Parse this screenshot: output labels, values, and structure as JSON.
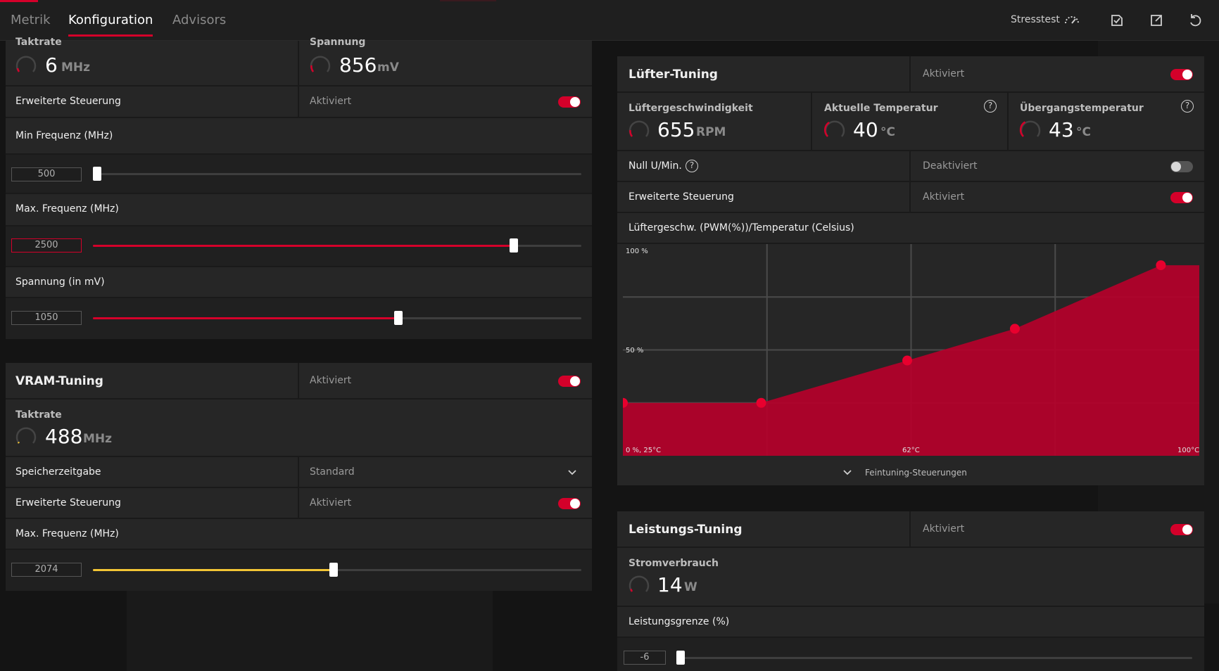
{
  "tabs": [
    {
      "label": "Metrik",
      "active": false
    },
    {
      "label": "Konfiguration",
      "active": true
    },
    {
      "label": "Advisors",
      "active": false
    }
  ],
  "toolbar": {
    "stress_label": "Stresstest"
  },
  "gpu_tuning": {
    "clock_label": "Taktrate",
    "clock_value": "6",
    "clock_unit": "MHz",
    "voltage_label": "Spannung",
    "voltage_value": "856",
    "voltage_unit": "mV",
    "advanced_label": "Erweiterte Steuerung",
    "advanced_state": "Aktiviert",
    "min_freq_label": "Min Frequenz (MHz)",
    "min_freq_value": "500",
    "max_freq_label": "Max. Frequenz (MHz)",
    "max_freq_value": "2500",
    "voltage_mv_label": "Spannung (in mV)",
    "voltage_mv_value": "1050"
  },
  "vram_tuning": {
    "title": "VRAM-Tuning",
    "state": "Aktiviert",
    "clock_label": "Taktrate",
    "clock_value": "488",
    "clock_unit": "MHz",
    "timing_label": "Speicherzeitgabe",
    "timing_value": "Standard",
    "advanced_label": "Erweiterte Steuerung",
    "advanced_state": "Aktiviert",
    "max_freq_label": "Max. Frequenz (MHz)",
    "max_freq_value": "2074"
  },
  "fan_tuning": {
    "title": "Lüfter-Tuning",
    "state": "Aktiviert",
    "speed_label": "Lüftergeschwindigkeit",
    "speed_value": "655",
    "speed_unit": "RPM",
    "temp_label": "Aktuelle Temperatur",
    "temp_value": "40",
    "temp_unit": "°C",
    "junction_label": "Übergangstemperatur",
    "junction_value": "43",
    "junction_unit": "°C",
    "zero_rpm_label": "Null U/Min.",
    "zero_rpm_state": "Deaktiviert",
    "advanced_label": "Erweiterte Steuerung",
    "advanced_state": "Aktiviert",
    "curve_label": "Lüftergeschw. (PWM(%))/Temperatur (Celsius)",
    "fine_tune_label": "Feintuning-Steuerungen"
  },
  "power_tuning": {
    "title": "Leistungs-Tuning",
    "state": "Aktiviert",
    "power_label": "Stromverbrauch",
    "power_value": "14",
    "power_unit": "W",
    "limit_label": "Leistungsgrenze (%)",
    "limit_value": "-6"
  },
  "chart_data": {
    "type": "area",
    "x": [
      25,
      43,
      62,
      76,
      95
    ],
    "values": [
      25,
      25,
      45,
      60,
      90
    ],
    "xlim": [
      25,
      100
    ],
    "ylim": [
      0,
      100
    ],
    "y_tick_labels": [
      "100 %",
      "50 %"
    ],
    "x_tick_labels": [
      "0 %, 25°C",
      "62°C",
      "100°C"
    ],
    "grid": true,
    "color": "#b5002a",
    "point_color": "#e8002e"
  },
  "colors": {
    "accent": "#d4002a",
    "vram_accent": "#f2c535"
  }
}
